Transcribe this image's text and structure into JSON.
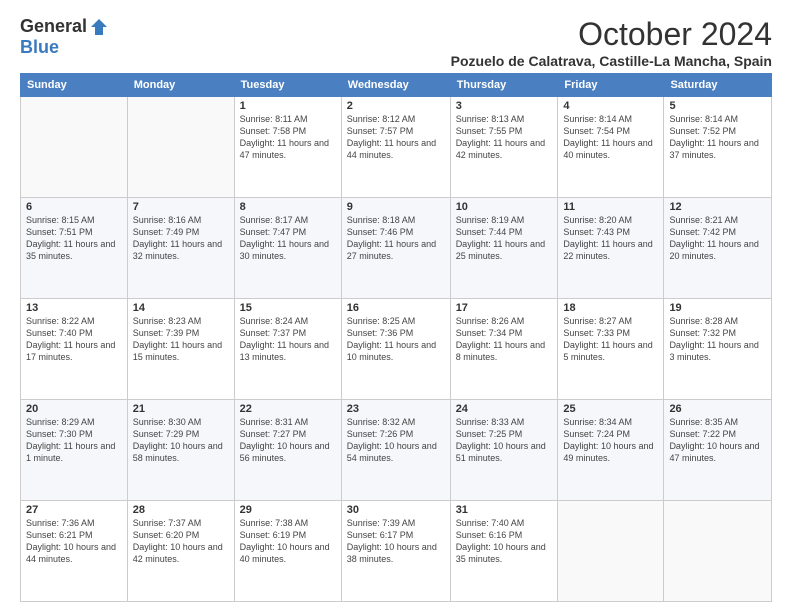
{
  "header": {
    "logo_general": "General",
    "logo_blue": "Blue",
    "title": "October 2024",
    "location": "Pozuelo de Calatrava, Castille-La Mancha, Spain"
  },
  "days_of_week": [
    "Sunday",
    "Monday",
    "Tuesday",
    "Wednesday",
    "Thursday",
    "Friday",
    "Saturday"
  ],
  "weeks": [
    [
      {
        "day": "",
        "info": ""
      },
      {
        "day": "",
        "info": ""
      },
      {
        "day": "1",
        "info": "Sunrise: 8:11 AM\nSunset: 7:58 PM\nDaylight: 11 hours and 47 minutes."
      },
      {
        "day": "2",
        "info": "Sunrise: 8:12 AM\nSunset: 7:57 PM\nDaylight: 11 hours and 44 minutes."
      },
      {
        "day": "3",
        "info": "Sunrise: 8:13 AM\nSunset: 7:55 PM\nDaylight: 11 hours and 42 minutes."
      },
      {
        "day": "4",
        "info": "Sunrise: 8:14 AM\nSunset: 7:54 PM\nDaylight: 11 hours and 40 minutes."
      },
      {
        "day": "5",
        "info": "Sunrise: 8:14 AM\nSunset: 7:52 PM\nDaylight: 11 hours and 37 minutes."
      }
    ],
    [
      {
        "day": "6",
        "info": "Sunrise: 8:15 AM\nSunset: 7:51 PM\nDaylight: 11 hours and 35 minutes."
      },
      {
        "day": "7",
        "info": "Sunrise: 8:16 AM\nSunset: 7:49 PM\nDaylight: 11 hours and 32 minutes."
      },
      {
        "day": "8",
        "info": "Sunrise: 8:17 AM\nSunset: 7:47 PM\nDaylight: 11 hours and 30 minutes."
      },
      {
        "day": "9",
        "info": "Sunrise: 8:18 AM\nSunset: 7:46 PM\nDaylight: 11 hours and 27 minutes."
      },
      {
        "day": "10",
        "info": "Sunrise: 8:19 AM\nSunset: 7:44 PM\nDaylight: 11 hours and 25 minutes."
      },
      {
        "day": "11",
        "info": "Sunrise: 8:20 AM\nSunset: 7:43 PM\nDaylight: 11 hours and 22 minutes."
      },
      {
        "day": "12",
        "info": "Sunrise: 8:21 AM\nSunset: 7:42 PM\nDaylight: 11 hours and 20 minutes."
      }
    ],
    [
      {
        "day": "13",
        "info": "Sunrise: 8:22 AM\nSunset: 7:40 PM\nDaylight: 11 hours and 17 minutes."
      },
      {
        "day": "14",
        "info": "Sunrise: 8:23 AM\nSunset: 7:39 PM\nDaylight: 11 hours and 15 minutes."
      },
      {
        "day": "15",
        "info": "Sunrise: 8:24 AM\nSunset: 7:37 PM\nDaylight: 11 hours and 13 minutes."
      },
      {
        "day": "16",
        "info": "Sunrise: 8:25 AM\nSunset: 7:36 PM\nDaylight: 11 hours and 10 minutes."
      },
      {
        "day": "17",
        "info": "Sunrise: 8:26 AM\nSunset: 7:34 PM\nDaylight: 11 hours and 8 minutes."
      },
      {
        "day": "18",
        "info": "Sunrise: 8:27 AM\nSunset: 7:33 PM\nDaylight: 11 hours and 5 minutes."
      },
      {
        "day": "19",
        "info": "Sunrise: 8:28 AM\nSunset: 7:32 PM\nDaylight: 11 hours and 3 minutes."
      }
    ],
    [
      {
        "day": "20",
        "info": "Sunrise: 8:29 AM\nSunset: 7:30 PM\nDaylight: 11 hours and 1 minute."
      },
      {
        "day": "21",
        "info": "Sunrise: 8:30 AM\nSunset: 7:29 PM\nDaylight: 10 hours and 58 minutes."
      },
      {
        "day": "22",
        "info": "Sunrise: 8:31 AM\nSunset: 7:27 PM\nDaylight: 10 hours and 56 minutes."
      },
      {
        "day": "23",
        "info": "Sunrise: 8:32 AM\nSunset: 7:26 PM\nDaylight: 10 hours and 54 minutes."
      },
      {
        "day": "24",
        "info": "Sunrise: 8:33 AM\nSunset: 7:25 PM\nDaylight: 10 hours and 51 minutes."
      },
      {
        "day": "25",
        "info": "Sunrise: 8:34 AM\nSunset: 7:24 PM\nDaylight: 10 hours and 49 minutes."
      },
      {
        "day": "26",
        "info": "Sunrise: 8:35 AM\nSunset: 7:22 PM\nDaylight: 10 hours and 47 minutes."
      }
    ],
    [
      {
        "day": "27",
        "info": "Sunrise: 7:36 AM\nSunset: 6:21 PM\nDaylight: 10 hours and 44 minutes."
      },
      {
        "day": "28",
        "info": "Sunrise: 7:37 AM\nSunset: 6:20 PM\nDaylight: 10 hours and 42 minutes."
      },
      {
        "day": "29",
        "info": "Sunrise: 7:38 AM\nSunset: 6:19 PM\nDaylight: 10 hours and 40 minutes."
      },
      {
        "day": "30",
        "info": "Sunrise: 7:39 AM\nSunset: 6:17 PM\nDaylight: 10 hours and 38 minutes."
      },
      {
        "day": "31",
        "info": "Sunrise: 7:40 AM\nSunset: 6:16 PM\nDaylight: 10 hours and 35 minutes."
      },
      {
        "day": "",
        "info": ""
      },
      {
        "day": "",
        "info": ""
      }
    ]
  ]
}
